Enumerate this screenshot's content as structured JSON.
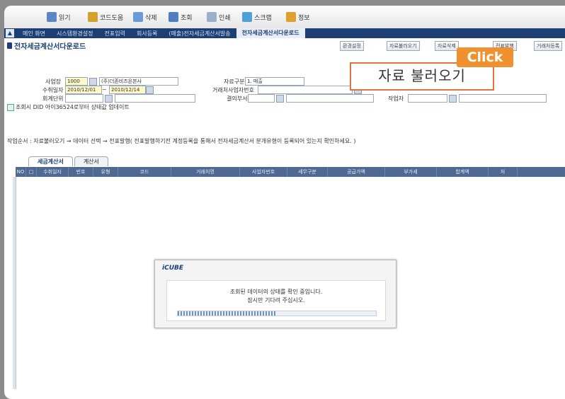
{
  "toolbar": {
    "buttons": [
      "읽기",
      "코드도움",
      "삭제",
      "조회",
      "인쇄",
      "스크랩",
      "정보"
    ],
    "icon_colors": [
      "#5a86c8",
      "#d4a22a",
      "#6b9ad6",
      "#4f7fc0",
      "#9ab0cc",
      "#4f9fd8",
      "#e0a030"
    ]
  },
  "menubar": {
    "items": [
      "메인 화면",
      "시스템환경설정",
      "전표입력",
      "회사등록",
      "(매출)전자세금계산서발송",
      "전자세금계산서다운로드"
    ],
    "active_index": 5
  },
  "page": {
    "title": "전자세금계산서다운로드",
    "right_buttons": [
      "환경설정",
      "자료불러오기",
      "자료삭제",
      "전표발행",
      "거래처등록"
    ]
  },
  "callout": {
    "label": "자료 불러오기",
    "badge": "Click"
  },
  "form": {
    "bizplace_label": "사업장",
    "bizplace_code": "1000",
    "bizplace_name": "(주)더존비즈온본사",
    "date_label": "수취일자",
    "date_from": "2010/12/01",
    "date_sep": "~",
    "date_to": "2010/12/14",
    "account_unit_label": "회계단위",
    "type_label": "자료구분",
    "type_value": "1. 매출",
    "partner_label": "거래처사업자번호",
    "dept_label": "결의부서",
    "writer_label": "작업자",
    "checkbox_label": "조회시 DID 아이36524로부터 상태값 업데이트"
  },
  "guide": "작업순서 : 자료불러오기 → 데이터 선택 → 전표발행( 전표발행하기전 계정등록을 통해서 전자세금계산서 분개유형이 등록되어 있는지 확인하세요. )",
  "tabs": [
    "세금계산서",
    "계산서"
  ],
  "grid": {
    "columns": [
      "NO",
      "□",
      "수취일자",
      "번호",
      "유형",
      "코드",
      "거래처명",
      "사업자번호",
      "세무구분",
      "공급가액",
      "부가세",
      "합계액",
      "처"
    ]
  },
  "loading": {
    "brand": "iCUBE",
    "line1": "조회된 데이터의 상태를 확인 중입니다.",
    "line2": "잠시만 기다려 주십시오.",
    "progress": 0.5
  }
}
